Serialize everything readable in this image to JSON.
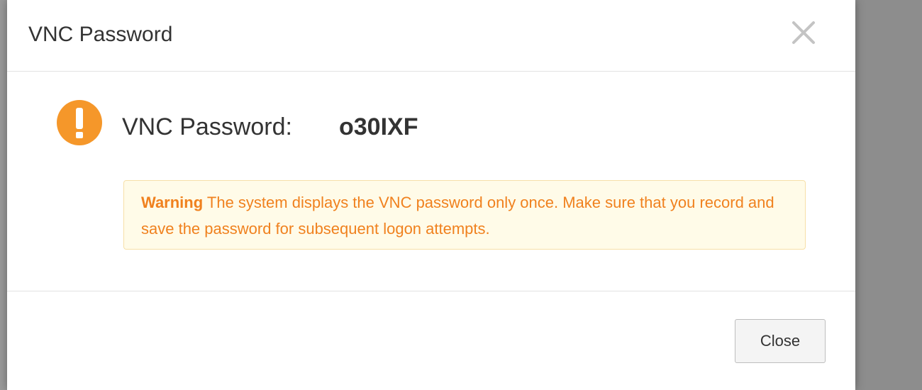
{
  "dialog": {
    "title": "VNC Password",
    "close_icon": "close-icon"
  },
  "content": {
    "alert_icon": "exclamation-icon",
    "password_label": "VNC Password:",
    "password_value": "o30IXF",
    "warning": {
      "label": "Warning",
      "message": "The system displays the VNC password only once. Make sure that you record and save the password for subsequent logon attempts."
    }
  },
  "footer": {
    "close_label": "Close"
  },
  "colors": {
    "accent_orange": "#f5972a",
    "warning_text": "#f0811e",
    "warning_bg": "#fffbe8",
    "warning_border": "#f7e0a8"
  }
}
